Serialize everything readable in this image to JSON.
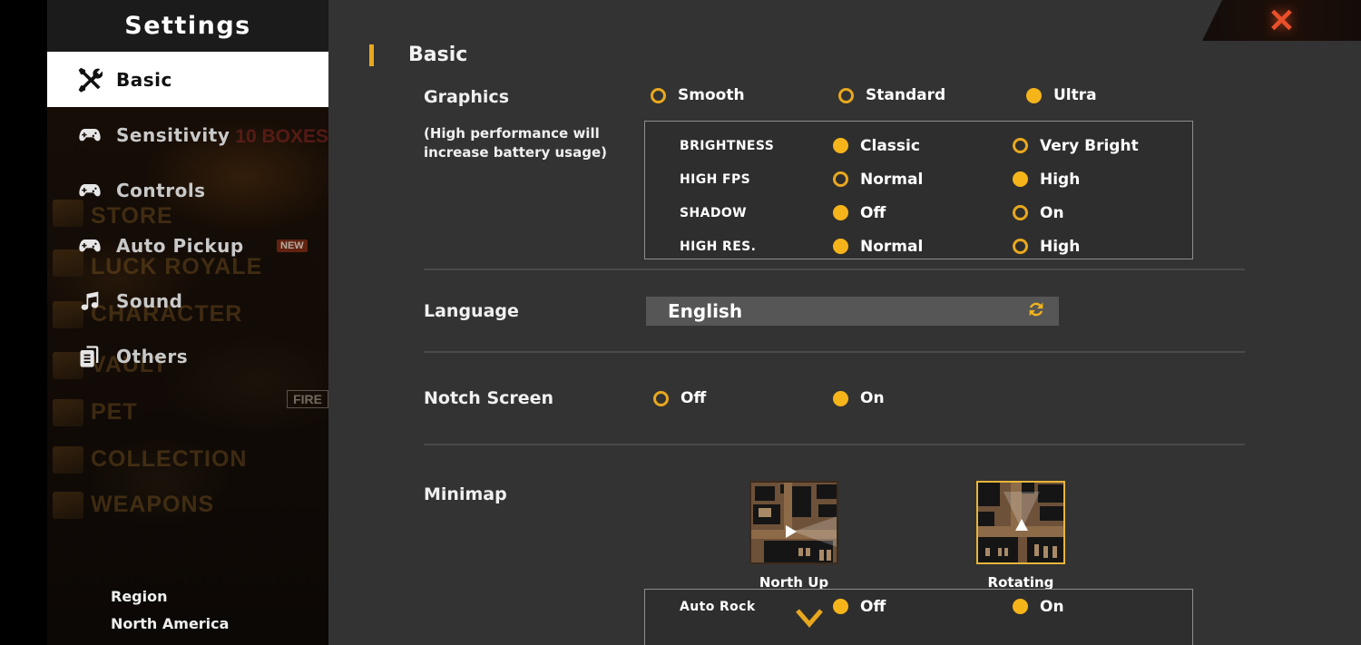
{
  "sidebar": {
    "title": "Settings",
    "items": [
      {
        "label": "Basic",
        "icon": "tools-icon",
        "active": true
      },
      {
        "label": "Sensitivity",
        "icon": "gamepad-icon",
        "active": false
      },
      {
        "label": "Controls",
        "icon": "gamepad-icon",
        "active": false
      },
      {
        "label": "Auto Pickup",
        "icon": "gamepad-icon",
        "active": false
      },
      {
        "label": "Sound",
        "icon": "music-note-icon",
        "active": false
      },
      {
        "label": "Others",
        "icon": "document-icon",
        "active": false
      }
    ],
    "region_label": "Region",
    "region_value": "North America",
    "background_menu": [
      "STORE",
      "LUCK ROYALE",
      "CHARACTER",
      "VAULT",
      "PET",
      "COLLECTION",
      "WEAPONS"
    ],
    "background_badges": [
      "NEW"
    ],
    "background_banner": "10 BOXES",
    "background_tag": "FIRE"
  },
  "main": {
    "close_label": "✕",
    "section_title": "Basic",
    "graphics": {
      "label": "Graphics",
      "note": "(High performance will increase battery usage)",
      "presets": [
        {
          "label": "Smooth",
          "selected": false
        },
        {
          "label": "Standard",
          "selected": false
        },
        {
          "label": "Ultra",
          "selected": true
        }
      ],
      "details": [
        {
          "name": "BRIGHTNESS",
          "options": [
            {
              "label": "Classic",
              "selected": true
            },
            {
              "label": "Very Bright",
              "selected": false
            }
          ]
        },
        {
          "name": "HIGH FPS",
          "options": [
            {
              "label": "Normal",
              "selected": false
            },
            {
              "label": "High",
              "selected": true
            }
          ]
        },
        {
          "name": "SHADOW",
          "options": [
            {
              "label": "Off",
              "selected": true
            },
            {
              "label": "On",
              "selected": false
            }
          ]
        },
        {
          "name": "HIGH RES.",
          "options": [
            {
              "label": "Normal",
              "selected": true
            },
            {
              "label": "High",
              "selected": false
            }
          ]
        }
      ]
    },
    "language": {
      "label": "Language",
      "value": "English",
      "swap_icon": "refresh-icon"
    },
    "notch_screen": {
      "label": "Notch Screen",
      "options": [
        {
          "label": "Off",
          "selected": false
        },
        {
          "label": "On",
          "selected": true
        }
      ]
    },
    "minimap": {
      "label": "Minimap",
      "choices": [
        {
          "label": "North Up",
          "selected": false
        },
        {
          "label": "Rotating",
          "selected": true
        }
      ]
    },
    "partial_row": {
      "name": "Auto Rock",
      "options": [
        {
          "label": "Off",
          "selected": true
        },
        {
          "label": "On",
          "selected": false
        }
      ]
    },
    "scroll_hint_icon": "chevron-down-icon"
  },
  "colors": {
    "accent": "#e8a81e",
    "accent_fill": "#f5b41a",
    "panel_bg": "#333333",
    "box_bg": "#2e2e2e",
    "sidebar_bg": "#0a0705",
    "close_x": "#e8502a",
    "field_bg": "#565656"
  }
}
